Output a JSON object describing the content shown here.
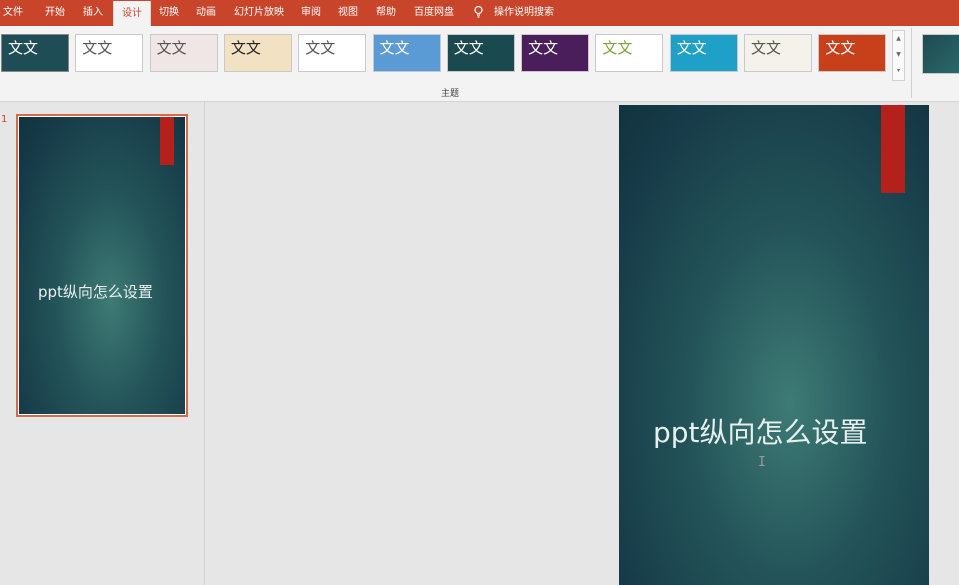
{
  "ribbon": {
    "tabs": [
      {
        "label": "文件",
        "active": false
      },
      {
        "label": "开始",
        "active": false
      },
      {
        "label": "插入",
        "active": false
      },
      {
        "label": "设计",
        "active": true
      },
      {
        "label": "切换",
        "active": false
      },
      {
        "label": "动画",
        "active": false
      },
      {
        "label": "幻灯片放映",
        "active": false
      },
      {
        "label": "审阅",
        "active": false
      },
      {
        "label": "视图",
        "active": false
      },
      {
        "label": "帮助",
        "active": false
      },
      {
        "label": "百度网盘",
        "active": false
      }
    ],
    "search_label": "操作说明搜索",
    "gallery_label": "主题",
    "themes": [
      {
        "name": "theme-1",
        "text": "文文",
        "bg": "#1f4d55",
        "fg": "#ffffff",
        "selected": true
      },
      {
        "name": "theme-2",
        "text": "文文",
        "bg": "#ffffff",
        "fg": "#555555"
      },
      {
        "name": "theme-3",
        "text": "文文",
        "bg": "#f0e6e6",
        "fg": "#555555"
      },
      {
        "name": "theme-4",
        "text": "文文",
        "bg": "#f3e1c4",
        "fg": "#222222"
      },
      {
        "name": "theme-5",
        "text": "文文",
        "bg": "#ffffff",
        "fg": "#555555"
      },
      {
        "name": "theme-6",
        "text": "文文",
        "bg": "#5b9bd5",
        "fg": "#ffffff"
      },
      {
        "name": "theme-7",
        "text": "文文",
        "bg": "#1a4a4f",
        "fg": "#ffffff"
      },
      {
        "name": "theme-8",
        "text": "文文",
        "bg": "#4a1e5a",
        "fg": "#ffffff"
      },
      {
        "name": "theme-9",
        "text": "文文",
        "bg": "#ffffff",
        "fg": "#7aa53b"
      },
      {
        "name": "theme-10",
        "text": "文文",
        "bg": "#1ea0c8",
        "fg": "#ffffff"
      },
      {
        "name": "theme-11",
        "text": "文文",
        "bg": "#f4f2ea",
        "fg": "#555555"
      },
      {
        "name": "theme-12",
        "text": "文文",
        "bg": "#c8401a",
        "fg": "#ffffff"
      }
    ]
  },
  "slides": {
    "current_number": "1",
    "title": "ppt纵向怎么设置"
  },
  "colors": {
    "accent": "#c8452c",
    "slide_red": "#b4201c"
  }
}
